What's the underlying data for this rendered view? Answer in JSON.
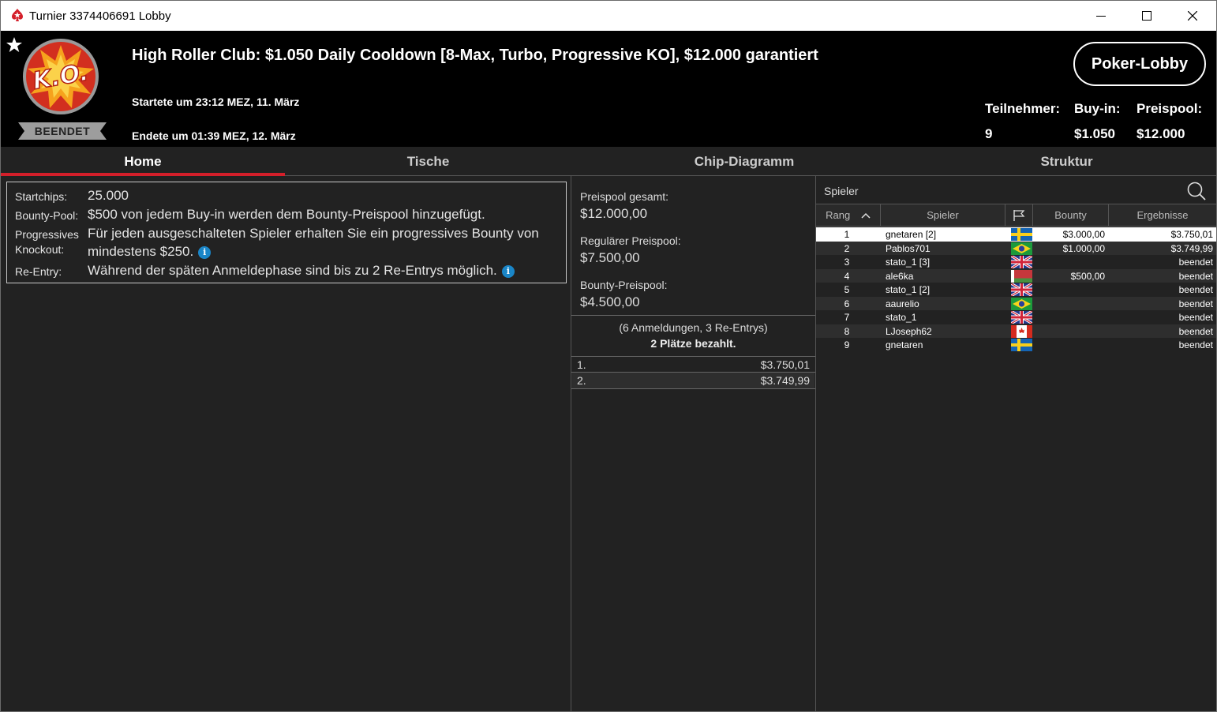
{
  "window": {
    "title": "Turnier 3374406691 Lobby"
  },
  "header": {
    "title": "High Roller Club: $1.050 Daily Cooldown [8-Max, Turbo, Progressive KO], $12.000 garantiert",
    "started": "Startete um 23:12 MEZ, 11. März",
    "ended": "Endete um 01:39 MEZ, 12. März",
    "status": "BEENDET",
    "logo_text": "K.O.",
    "lobby_button": "Poker-Lobby",
    "stats": {
      "participants_label": "Teilnehmer:",
      "participants": "9",
      "buyin_label": "Buy-in:",
      "buyin": "$1.050",
      "prizepool_label": "Preispool:",
      "prizepool": "$12.000"
    }
  },
  "tabs": [
    {
      "label": "Home",
      "active": true
    },
    {
      "label": "Tische"
    },
    {
      "label": "Chip-Diagramm"
    },
    {
      "label": "Struktur"
    }
  ],
  "info": {
    "startchips_label": "Startchips:",
    "startchips": "25.000",
    "bountypool_label": "Bounty-Pool:",
    "bountypool": "$500 von jedem Buy-in werden dem Bounty-Preispool hinzugefügt.",
    "pko_label_1": "Progressives",
    "pko_label_2": "Knockout:",
    "pko_line1": "Für jeden ausgeschalteten Spieler erhalten Sie ein progressives Bounty von",
    "pko_line2": "mindestens $250.",
    "reentry_label": "Re-Entry:",
    "reentry": "Während der späten Anmeldephase sind bis zu 2 Re-Entrys möglich.",
    "info_glyph": "i"
  },
  "prize": {
    "total_label": "Preispool gesamt:",
    "total": "$12.000,00",
    "regular_label": "Regulärer Preispool:",
    "regular": "$7.500,00",
    "bounty_label": "Bounty-Preispool:",
    "bounty": "$4.500,00",
    "entries": "(6 Anmeldungen, 3 Re-Entrys)",
    "paid": "2 Plätze bezahlt.",
    "payouts": [
      {
        "pos": "1.",
        "amount": "$3.750,01"
      },
      {
        "pos": "2.",
        "amount": "$3.749,99"
      }
    ]
  },
  "players": {
    "search_label": "Spieler",
    "columns": {
      "rank": "Rang",
      "player": "Spieler",
      "bounty": "Bounty",
      "result": "Ergebnisse"
    },
    "rows": [
      {
        "rank": "1",
        "name": "gnetaren [2]",
        "flag": "sweden",
        "bounty": "$3.000,00",
        "result": "$3.750,01"
      },
      {
        "rank": "2",
        "name": "Pablos701",
        "flag": "brazil",
        "bounty": "$1.000,00",
        "result": "$3.749,99"
      },
      {
        "rank": "3",
        "name": "stato_1 [3]",
        "flag": "uk",
        "bounty": "",
        "result": "beendet"
      },
      {
        "rank": "4",
        "name": "ale6ka",
        "flag": "belarus",
        "bounty": "$500,00",
        "result": "beendet"
      },
      {
        "rank": "5",
        "name": "stato_1 [2]",
        "flag": "uk",
        "bounty": "",
        "result": "beendet"
      },
      {
        "rank": "6",
        "name": "aaurelio",
        "flag": "brazil",
        "bounty": "",
        "result": "beendet"
      },
      {
        "rank": "7",
        "name": "stato_1",
        "flag": "uk",
        "bounty": "",
        "result": "beendet"
      },
      {
        "rank": "8",
        "name": "LJoseph62",
        "flag": "canada",
        "bounty": "",
        "result": "beendet"
      },
      {
        "rank": "9",
        "name": "gnetaren",
        "flag": "sweden",
        "bounty": "",
        "result": "beendet"
      }
    ]
  },
  "colors": {
    "accent": "#d41f2a",
    "info": "#1a86c8",
    "background": "#222222",
    "header": "#000000"
  }
}
